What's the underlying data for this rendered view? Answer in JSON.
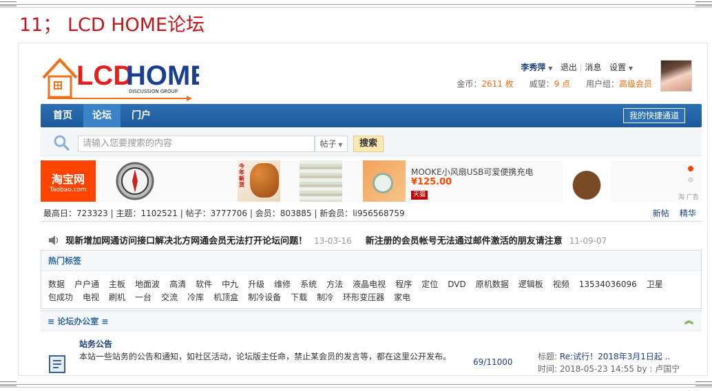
{
  "slide": {
    "title": "11； LCD HOME论坛"
  },
  "logo": {
    "main": "LCD HOME",
    "sub": "DISCUSSION GROUP"
  },
  "user": {
    "name": "李秀萍",
    "logout": "退出",
    "messages": "消息",
    "settings": "设置",
    "coins_label": "金币：",
    "coins_value": "2611 枚",
    "prestige_label": "威望：",
    "prestige_value": "9 点",
    "group_label": "用户组：",
    "group_value": "高级会员"
  },
  "nav": {
    "items": [
      {
        "label": "首页"
      },
      {
        "label": "论坛"
      },
      {
        "label": "门户"
      }
    ],
    "quick_label": "我的快捷通道"
  },
  "search": {
    "placeholder": "请输入您要搜索的内容",
    "type": "帖子",
    "button": "搜索"
  },
  "ad": {
    "brand": "淘宝网",
    "brand_sub": "Taobao.com",
    "title": "MOOKE小风扇USB可爱便携充电",
    "price": "¥125.00",
    "tmall": "天猫",
    "tag": "淘 广告",
    "banner_text": "今年新货"
  },
  "stats": {
    "text": "最高日：723323 | 主题：1102521 | 帖子：3777706 | 会员：803885 | 新会员：li956568759",
    "links": [
      "新帖",
      "精华"
    ]
  },
  "notices": [
    {
      "text": "现新增加网通访问接口解决北方网通会员无法打开论坛问题！",
      "date": "13-03-16"
    },
    {
      "text": "新注册的会员帐号无法通过邮件激活的朋友请注意",
      "date": "11-09-07"
    }
  ],
  "hot_tags": {
    "title": "热门标签",
    "tags": [
      "数据",
      "户户通",
      "主板",
      "地面波",
      "高清",
      "软件",
      "中九",
      "升级",
      "维修",
      "系统",
      "方法",
      "液晶电视",
      "程序",
      "定位",
      "DVD",
      "原机数据",
      "逻辑板",
      "视频",
      "13534036096",
      "卫星",
      "包成功",
      "电视",
      "刷机",
      "一台",
      "交流",
      "冷库",
      "机顶盒",
      "制冷设备",
      "下载",
      "制冷",
      "环形变压器",
      "家电"
    ]
  },
  "office": {
    "title": "≡ 论坛办公室 ≡"
  },
  "forum_row": {
    "title": "站务公告",
    "desc": "本站一些站务的公告和通知，如社区活动，论坛版主任命，禁止某会员的发言等，都在这里公开发布。",
    "count": "69/11000",
    "last_title_label": "标题: ",
    "last_title": "Re:试行！2018年3月1日起 ..",
    "last_time": "时间: 2018-05-23 14:55 by : 卢国宁"
  }
}
